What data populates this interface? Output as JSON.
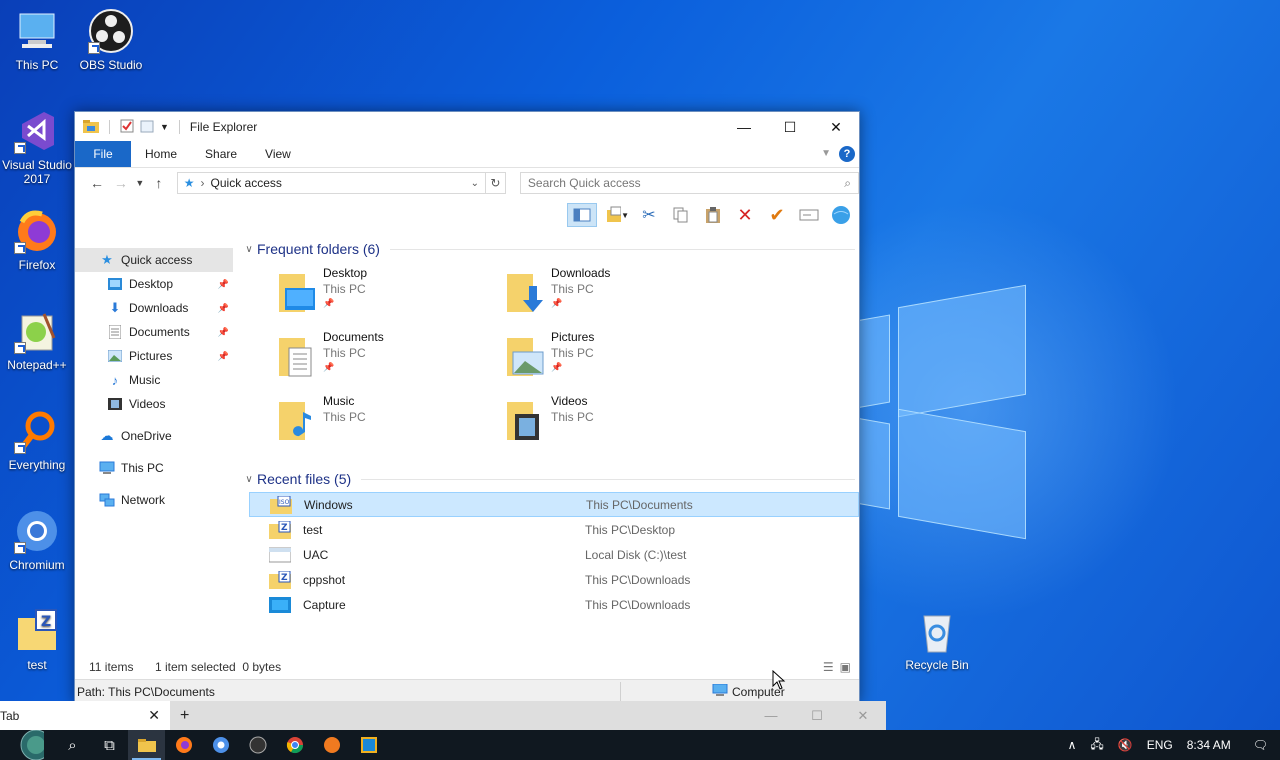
{
  "desktop": {
    "icons": [
      {
        "label": "This PC"
      },
      {
        "label": "OBS Studio"
      },
      {
        "label": "Visual Studio 2017"
      },
      {
        "label": "Firefox"
      },
      {
        "label": "Notepad++"
      },
      {
        "label": "Everything"
      },
      {
        "label": "Chromium"
      },
      {
        "label": "test"
      },
      {
        "label": "Recycle Bin"
      }
    ]
  },
  "explorer": {
    "title": "File Explorer",
    "ribbon_tabs": [
      "File",
      "Home",
      "Share",
      "View"
    ],
    "help_label": "?",
    "address": "Quick access",
    "search_placeholder": "Search Quick access",
    "nav": {
      "quick_access": "Quick access",
      "pinned": [
        "Desktop",
        "Downloads",
        "Documents",
        "Pictures"
      ],
      "unpinned": [
        "Music",
        "Videos"
      ],
      "onedrive": "OneDrive",
      "this_pc": "This PC",
      "network": "Network"
    },
    "frequent": {
      "heading": "Frequent folders (6)",
      "items": [
        {
          "name": "Desktop",
          "loc": "This PC"
        },
        {
          "name": "Downloads",
          "loc": "This PC"
        },
        {
          "name": "Documents",
          "loc": "This PC"
        },
        {
          "name": "Pictures",
          "loc": "This PC"
        },
        {
          "name": "Music",
          "loc": "This PC"
        },
        {
          "name": "Videos",
          "loc": "This PC"
        }
      ]
    },
    "recent": {
      "heading": "Recent files (5)",
      "items": [
        {
          "name": "Windows",
          "path": "This PC\\Documents"
        },
        {
          "name": "test",
          "path": "This PC\\Desktop"
        },
        {
          "name": "UAC",
          "path": "Local Disk (C:)\\test"
        },
        {
          "name": "cppshot",
          "path": "This PC\\Downloads"
        },
        {
          "name": "Capture",
          "path": "This PC\\Downloads"
        }
      ]
    },
    "status": {
      "count": "11 items",
      "selection": "1 item selected  0 bytes"
    },
    "pathbar": {
      "path": "Path: This PC\\Documents",
      "location": "Computer"
    }
  },
  "browser": {
    "tab": "Tab",
    "plus": "+"
  },
  "taskbar": {
    "lang": "ENG",
    "time": "8:34 AM"
  },
  "colors": {
    "accent": "#1a68c8",
    "selection": "#cce8ff",
    "group_heading": "#1e3287"
  }
}
